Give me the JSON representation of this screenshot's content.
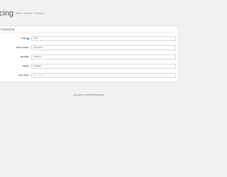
{
  "header": {
    "title": "cing",
    "breadcrumb": {
      "home": "Home",
      "section": "Finance",
      "current": "Financing"
    }
  },
  "panel": {
    "title": "Financing"
  },
  "form": {
    "fields": [
      {
        "label": "Total",
        "value": "6.67",
        "has_info": true
      },
      {
        "label": "Order Status",
        "value": "Canceled"
      },
      {
        "label": "Net Date",
        "value": "7/1/2xxx"
      },
      {
        "label": "Status",
        "value": "Enabled"
      },
      {
        "label": "Item Order",
        "value": "",
        "placeholder": "Sort Order"
      }
    ]
  },
  "footer": {
    "text": "Copyright by INFORMATICAZEN"
  },
  "icons": {
    "info": "info-icon"
  }
}
